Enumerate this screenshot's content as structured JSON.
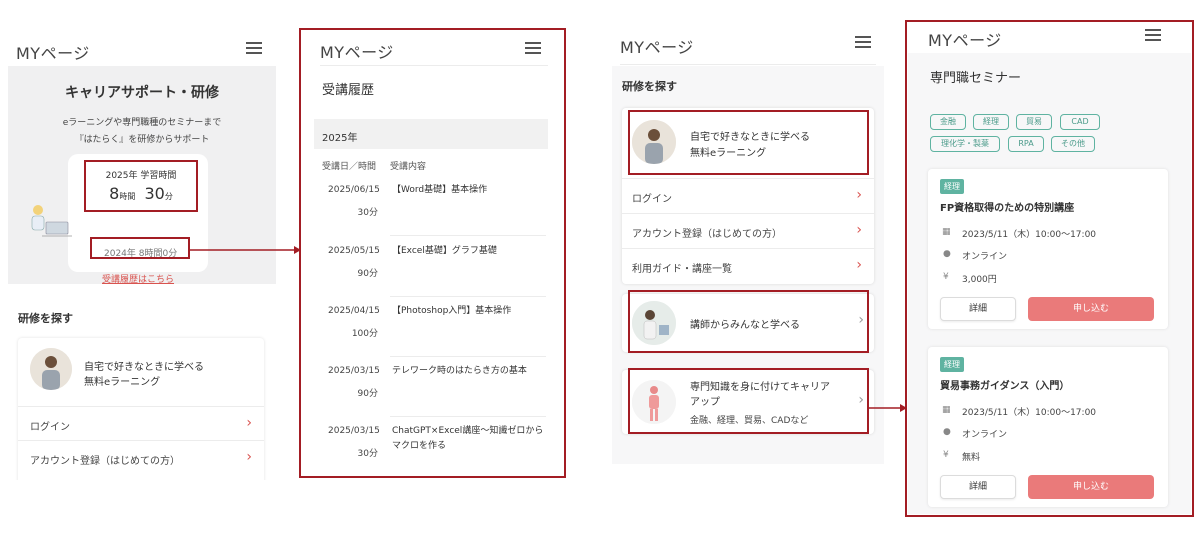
{
  "screen1": {
    "logo": "MYページ",
    "hero_title": "キャリアサポート・研修",
    "hero_sub1": "eラーニングや専門職種のセミナーまで",
    "hero_sub2": "『はたらく』を研修からサポート",
    "study_label": "2025年 学習時間",
    "study_hours": "8",
    "study_hours_unit": "時間",
    "study_minutes": "30",
    "study_minutes_unit": "分",
    "prev_year": "2024年 8時間0分",
    "history_link": "受講履歴はこちら",
    "section_title": "研修を探す",
    "elearning_line1": "自宅で好きなときに学べる",
    "elearning_line2": "無料eラーニング",
    "rows": [
      "ログイン",
      "アカウント登録（はじめての方）"
    ]
  },
  "screen2": {
    "logo": "MYページ",
    "title": "受講履歴",
    "year": "2025年",
    "col_date": "受講日／時間",
    "col_content": "受講内容",
    "items": [
      {
        "date": "2025/06/15",
        "min": "30分",
        "title": "【Word基礎】基本操作"
      },
      {
        "date": "2025/05/15",
        "min": "90分",
        "title": "【Excel基礎】グラフ基礎"
      },
      {
        "date": "2025/04/15",
        "min": "100分",
        "title": "【Photoshop入門】基本操作"
      },
      {
        "date": "2025/03/15",
        "min": "90分",
        "title": "テレワーク時のはたらき方の基本"
      },
      {
        "date": "2025/03/15",
        "min": "30分",
        "title": "ChatGPT×Excel講座〜知識ゼロからマクロを作る"
      }
    ]
  },
  "screen3": {
    "logo": "MYページ",
    "section_title": "研修を探す",
    "elearning_line1": "自宅で好きなときに学べる",
    "elearning_line2": "無料eラーニング",
    "rows": [
      "ログイン",
      "アカウント登録（はじめての方）",
      "利用ガイド・講座一覧"
    ],
    "teacher": "講師からみんなと学べる",
    "expert_line1": "専門知識を身に付けてキャリア",
    "expert_line2": "アップ",
    "expert_sub": "金融、経理、貿易、CADなど"
  },
  "screen4": {
    "logo": "MYページ",
    "title": "専門職セミナー",
    "tags": [
      "金融",
      "経理",
      "貿易",
      "CAD",
      "理化学・製薬",
      "RPA",
      "その他"
    ],
    "seminars": [
      {
        "category": "経理",
        "title": "FP資格取得のための特別講座",
        "datetime": "2023/5/11（木）10:00〜17:00",
        "place": "オンライン",
        "price": "3,000円",
        "detail": "詳細",
        "apply": "申し込む"
      },
      {
        "category": "経理",
        "title": "貿易事務ガイダンス（入門）",
        "datetime": "2023/5/11（木）10:00〜17:00",
        "place": "オンライン",
        "price": "無料",
        "detail": "詳細",
        "apply": "申し込む"
      }
    ]
  },
  "icons": {
    "menu": "hamburger-icon",
    "chevron": "chevron-right-icon",
    "calendar": "calendar-icon",
    "pin": "location-pin-icon",
    "yen": "yen-icon"
  },
  "colors": {
    "frame": "#a31d24",
    "accent": "#ea7a7a",
    "tag": "#5fb3a1",
    "link": "#d9534f"
  }
}
